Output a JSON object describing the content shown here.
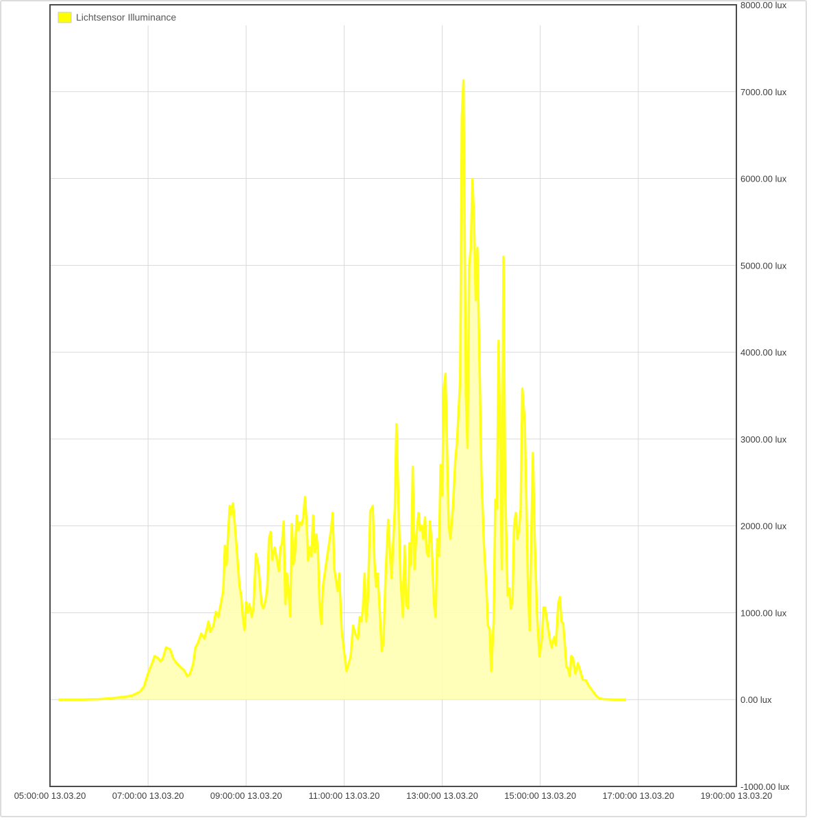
{
  "chart_data": {
    "type": "area",
    "series": [
      {
        "name": "Lichtsensor Illuminance",
        "points": [
          [
            "05:10",
            0
          ],
          [
            "05:40",
            0
          ],
          [
            "06:00",
            5
          ],
          [
            "06:15",
            15
          ],
          [
            "06:30",
            30
          ],
          [
            "06:40",
            45
          ],
          [
            "06:50",
            90
          ],
          [
            "06:55",
            150
          ],
          [
            "07:00",
            300
          ],
          [
            "07:05",
            420
          ],
          [
            "07:08",
            500
          ],
          [
            "07:12",
            480
          ],
          [
            "07:15",
            440
          ],
          [
            "07:18",
            470
          ],
          [
            "07:22",
            600
          ],
          [
            "07:27",
            580
          ],
          [
            "07:31",
            470
          ],
          [
            "07:35",
            420
          ],
          [
            "07:40",
            370
          ],
          [
            "07:44",
            340
          ],
          [
            "07:48",
            270
          ],
          [
            "07:51",
            290
          ],
          [
            "07:55",
            400
          ],
          [
            "07:58",
            600
          ],
          [
            "08:01",
            650
          ],
          [
            "08:05",
            760
          ],
          [
            "08:09",
            700
          ],
          [
            "08:14",
            900
          ],
          [
            "08:16",
            780
          ],
          [
            "08:20",
            850
          ],
          [
            "08:23",
            1010
          ],
          [
            "08:26",
            950
          ],
          [
            "08:29",
            1100
          ],
          [
            "08:32",
            1250
          ],
          [
            "08:34",
            1770
          ],
          [
            "08:36",
            1550
          ],
          [
            "08:38",
            1900
          ],
          [
            "08:40",
            2230
          ],
          [
            "08:42",
            2130
          ],
          [
            "08:44",
            2260
          ],
          [
            "08:48",
            1800
          ],
          [
            "08:52",
            1300
          ],
          [
            "08:54",
            1200
          ],
          [
            "08:56",
            950
          ],
          [
            "08:58",
            800
          ],
          [
            "09:00",
            1120
          ],
          [
            "09:02",
            1000
          ],
          [
            "09:04",
            1100
          ],
          [
            "09:07",
            950
          ],
          [
            "09:09",
            1050
          ],
          [
            "09:12",
            1680
          ],
          [
            "09:15",
            1550
          ],
          [
            "09:19",
            1100
          ],
          [
            "09:21",
            1050
          ],
          [
            "09:24",
            1150
          ],
          [
            "09:26",
            1300
          ],
          [
            "09:28",
            1850
          ],
          [
            "09:30",
            1930
          ],
          [
            "09:32",
            1610
          ],
          [
            "09:35",
            1750
          ],
          [
            "09:38",
            1600
          ],
          [
            "09:40",
            1480
          ],
          [
            "09:42",
            1750
          ],
          [
            "09:44",
            1800
          ],
          [
            "09:46",
            2050
          ],
          [
            "09:48",
            1100
          ],
          [
            "09:50",
            1450
          ],
          [
            "09:52",
            1250
          ],
          [
            "09:54",
            960
          ],
          [
            "09:56",
            2020
          ],
          [
            "09:58",
            1560
          ],
          [
            "10:00",
            1700
          ],
          [
            "10:02",
            2120
          ],
          [
            "10:04",
            1950
          ],
          [
            "10:06",
            2040
          ],
          [
            "10:08",
            2010
          ],
          [
            "10:10",
            2100
          ],
          [
            "10:12",
            2330
          ],
          [
            "10:14",
            2050
          ],
          [
            "10:16",
            1600
          ],
          [
            "10:18",
            1750
          ],
          [
            "10:20",
            1650
          ],
          [
            "10:22",
            2120
          ],
          [
            "10:24",
            1700
          ],
          [
            "10:26",
            1900
          ],
          [
            "10:28",
            1700
          ],
          [
            "10:30",
            1100
          ],
          [
            "10:32",
            870
          ],
          [
            "10:34",
            1300
          ],
          [
            "10:40",
            1700
          ],
          [
            "10:44",
            1950
          ],
          [
            "10:46",
            2150
          ],
          [
            "10:48",
            1500
          ],
          [
            "10:52",
            1250
          ],
          [
            "10:54",
            1450
          ],
          [
            "10:57",
            800
          ],
          [
            "11:00",
            550
          ],
          [
            "11:03",
            330
          ],
          [
            "11:08",
            500
          ],
          [
            "11:11",
            850
          ],
          [
            "11:14",
            750
          ],
          [
            "11:17",
            700
          ],
          [
            "11:19",
            950
          ],
          [
            "11:21",
            900
          ],
          [
            "11:23",
            1050
          ],
          [
            "11:25",
            1450
          ],
          [
            "11:27",
            900
          ],
          [
            "11:29",
            1150
          ],
          [
            "11:32",
            2170
          ],
          [
            "11:35",
            2230
          ],
          [
            "11:37",
            1600
          ],
          [
            "11:39",
            1300
          ],
          [
            "11:41",
            1450
          ],
          [
            "11:44",
            950
          ],
          [
            "11:46",
            560
          ],
          [
            "11:48",
            650
          ],
          [
            "11:51",
            1500
          ],
          [
            "11:54",
            2070
          ],
          [
            "11:56",
            1700
          ],
          [
            "11:58",
            1400
          ],
          [
            "12:02",
            2200
          ],
          [
            "12:04",
            3170
          ],
          [
            "12:07",
            2100
          ],
          [
            "12:09",
            1400
          ],
          [
            "12:12",
            950
          ],
          [
            "12:14",
            1770
          ],
          [
            "12:16",
            1100
          ],
          [
            "12:18",
            1050
          ],
          [
            "12:20",
            1800
          ],
          [
            "12:22",
            1550
          ],
          [
            "12:24",
            2680
          ],
          [
            "12:26",
            1500
          ],
          [
            "12:28",
            1850
          ],
          [
            "12:31",
            2150
          ],
          [
            "12:33",
            1950
          ],
          [
            "12:35",
            2000
          ],
          [
            "12:37",
            1850
          ],
          [
            "12:39",
            2100
          ],
          [
            "12:41",
            1700
          ],
          [
            "12:43",
            1650
          ],
          [
            "12:45",
            2050
          ],
          [
            "12:47",
            1800
          ],
          [
            "12:50",
            1100
          ],
          [
            "12:52",
            950
          ],
          [
            "12:54",
            1850
          ],
          [
            "12:56",
            1650
          ],
          [
            "12:58",
            2700
          ],
          [
            "13:00",
            2350
          ],
          [
            "13:02",
            3600
          ],
          [
            "13:04",
            3750
          ],
          [
            "13:08",
            2000
          ],
          [
            "13:10",
            1850
          ],
          [
            "13:13",
            2200
          ],
          [
            "13:16",
            2750
          ],
          [
            "13:18",
            2950
          ],
          [
            "13:20",
            3300
          ],
          [
            "13:22",
            3700
          ],
          [
            "13:24",
            6700
          ],
          [
            "13:26",
            7130
          ],
          [
            "13:29",
            3500
          ],
          [
            "13:31",
            2900
          ],
          [
            "13:33",
            5000
          ],
          [
            "13:35",
            5200
          ],
          [
            "13:37",
            5990
          ],
          [
            "13:39",
            5500
          ],
          [
            "13:41",
            4600
          ],
          [
            "13:43",
            5200
          ],
          [
            "13:46",
            3700
          ],
          [
            "13:48",
            2600
          ],
          [
            "13:51",
            1800
          ],
          [
            "13:54",
            1300
          ],
          [
            "13:56",
            850
          ],
          [
            "13:58",
            810
          ],
          [
            "14:00",
            330
          ],
          [
            "14:03",
            900
          ],
          [
            "14:05",
            2300
          ],
          [
            "14:07",
            2200
          ],
          [
            "14:09",
            4130
          ],
          [
            "14:11",
            2900
          ],
          [
            "14:13",
            1500
          ],
          [
            "14:15",
            5100
          ],
          [
            "14:17",
            2500
          ],
          [
            "14:20",
            1200
          ],
          [
            "14:22",
            1280
          ],
          [
            "14:24",
            1050
          ],
          [
            "14:26",
            1150
          ],
          [
            "14:28",
            2000
          ],
          [
            "14:30",
            2150
          ],
          [
            "14:32",
            1850
          ],
          [
            "14:34",
            1950
          ],
          [
            "14:36",
            2200
          ],
          [
            "14:38",
            3580
          ],
          [
            "14:41",
            3200
          ],
          [
            "14:43",
            2300
          ],
          [
            "14:45",
            1300
          ],
          [
            "14:47",
            800
          ],
          [
            "14:49",
            1900
          ],
          [
            "14:51",
            2840
          ],
          [
            "14:53",
            1900
          ],
          [
            "14:56",
            1000
          ],
          [
            "14:59",
            500
          ],
          [
            "15:02",
            700
          ],
          [
            "15:04",
            1060
          ],
          [
            "15:06",
            1060
          ],
          [
            "15:10",
            800
          ],
          [
            "15:12",
            680
          ],
          [
            "15:14",
            600
          ],
          [
            "15:17",
            720
          ],
          [
            "15:19",
            630
          ],
          [
            "15:22",
            1100
          ],
          [
            "15:24",
            1180
          ],
          [
            "15:26",
            900
          ],
          [
            "15:28",
            880
          ],
          [
            "15:30",
            650
          ],
          [
            "15:32",
            380
          ],
          [
            "15:34",
            360
          ],
          [
            "15:36",
            270
          ],
          [
            "15:38",
            500
          ],
          [
            "15:40",
            480
          ],
          [
            "15:43",
            300
          ],
          [
            "15:46",
            420
          ],
          [
            "15:49",
            330
          ],
          [
            "15:52",
            230
          ],
          [
            "15:56",
            220
          ],
          [
            "16:00",
            150
          ],
          [
            "16:04",
            100
          ],
          [
            "16:08",
            50
          ],
          [
            "16:12",
            15
          ],
          [
            "16:18",
            5
          ],
          [
            "16:30",
            0
          ],
          [
            "16:45",
            0
          ]
        ]
      }
    ],
    "x_tick_labels": [
      "05:00:00 13.03.20",
      "07:00:00 13.03.20",
      "09:00:00 13.03.20",
      "11:00:00 13.03.20",
      "13:00:00 13.03.20",
      "15:00:00 13.03.20",
      "17:00:00 13.03.20",
      "19:00:00 13.03.20"
    ],
    "y_tick_labels": [
      "8000.00 lux",
      "7000.00 lux",
      "6000.00 lux",
      "5000.00 lux",
      "4000.00 lux",
      "3000.00 lux",
      "2000.00 lux",
      "1000.00 lux",
      "0.00 lux",
      "-1000.00 lux"
    ],
    "ylim": [
      -1000,
      8000
    ],
    "xlim": [
      "05:00",
      "19:00"
    ],
    "grid": true,
    "legend_position": "top-left",
    "colors": {
      "line": "#ffff1a",
      "fill": "#ffffb3",
      "legend_box": "#ffff00",
      "grid": "#d9d9d9",
      "axis": "#4a4a4a"
    }
  }
}
